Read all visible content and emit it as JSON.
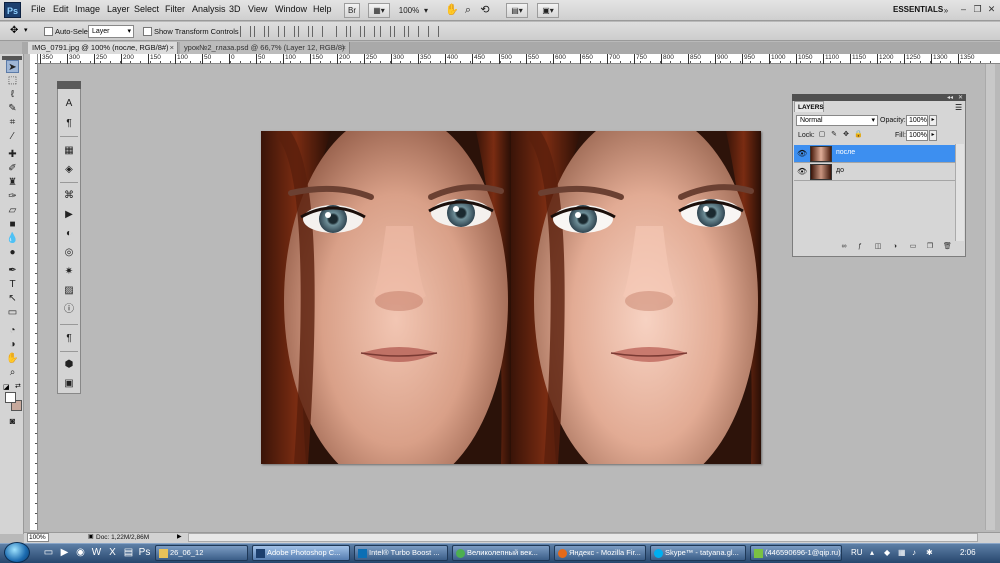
{
  "menubar": {
    "logo": "Ps",
    "items": [
      "File",
      "Edit",
      "Image",
      "Layer",
      "Select",
      "Filter",
      "Analysis",
      "3D",
      "View",
      "Window",
      "Help"
    ],
    "zoom_value": "100%",
    "workspace": "ESSENTIALS"
  },
  "options": {
    "auto_select_label": "Auto-Select:",
    "auto_select_value": "Layer",
    "show_transform_label": "Show Transform Controls"
  },
  "tabs": [
    {
      "label": "IMG_0791.jpg @ 100% (после, RGB/8#)",
      "close": "×"
    },
    {
      "label": "урок№2_глаза.psd @ 66,7% (Layer 12, RGB/8)",
      "close": "×"
    }
  ],
  "ruler": {
    "ticks": [
      "350",
      "300",
      "250",
      "200",
      "150",
      "100",
      "50",
      "0",
      "50",
      "100",
      "150",
      "200",
      "250",
      "300",
      "350",
      "400",
      "450",
      "500",
      "550",
      "600",
      "650",
      "700",
      "750",
      "800",
      "850",
      "900",
      "950",
      "1000",
      "1050",
      "1100",
      "1150",
      "1200",
      "1250",
      "1300",
      "1350"
    ]
  },
  "layers": {
    "tab": "LAYERS",
    "blend_mode": "Normal",
    "opacity_label": "Opacity:",
    "opacity_value": "100%",
    "lock_label": "Lock:",
    "fill_label": "Fill:",
    "fill_value": "100%",
    "rows": [
      {
        "name": "после",
        "selected": true
      },
      {
        "name": "до",
        "selected": false
      }
    ]
  },
  "status": {
    "zoom": "100%",
    "doc": "Doc: 1,22M/2,86M"
  },
  "taskbar": {
    "buttons": [
      {
        "label": "26_06_12"
      },
      {
        "label": "Adobe Photoshop C..."
      },
      {
        "label": "Intel® Turbo Boost ..."
      },
      {
        "label": "Великолепный век..."
      },
      {
        "label": "Яндекс - Mozilla Fir..."
      },
      {
        "label": "Skype™ - tatyana.gl..."
      },
      {
        "label": "(446590696-1@qip.ru)"
      }
    ],
    "lang": "RU",
    "time": "2:06"
  },
  "colors": {
    "accent_selected_layer": "#3d8ff0",
    "background_swatch": "#c7a99c",
    "foreground_swatch": "#ffffff"
  }
}
